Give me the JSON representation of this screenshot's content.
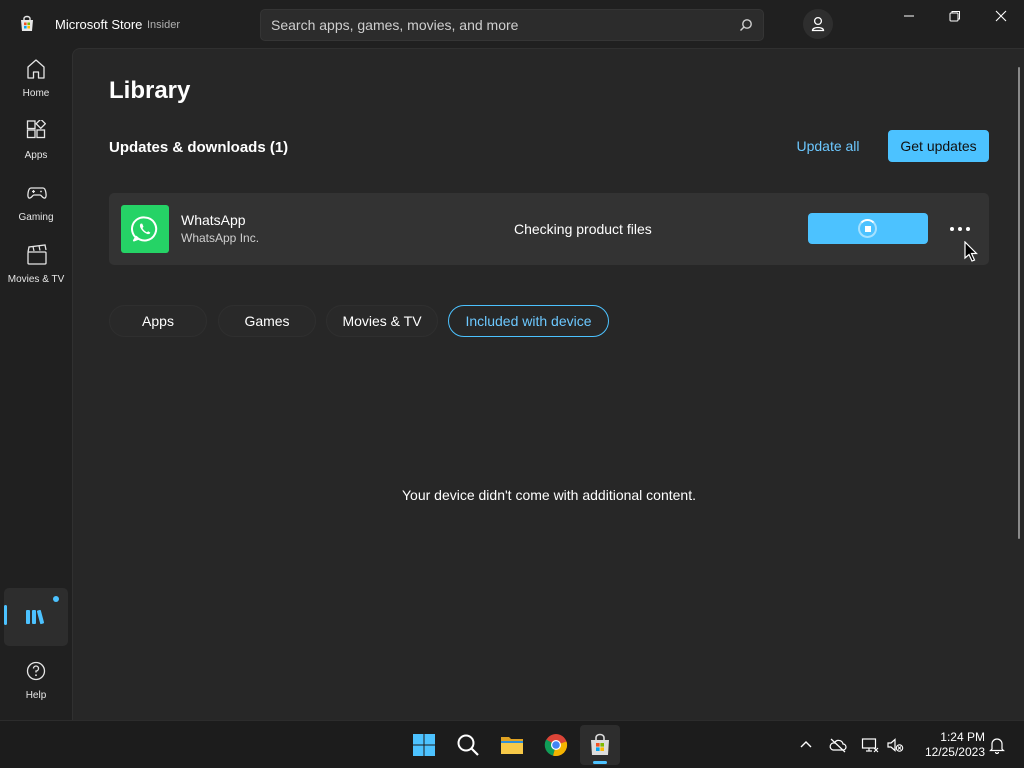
{
  "titlebar": {
    "app_name": "Microsoft Store",
    "badge": "Insider",
    "search_placeholder": "Search apps, games, movies, and more"
  },
  "sidebar": {
    "items": [
      {
        "label": "Home",
        "icon": "home-icon"
      },
      {
        "label": "Apps",
        "icon": "apps-icon"
      },
      {
        "label": "Gaming",
        "icon": "gamepad-icon"
      },
      {
        "label": "Movies & TV",
        "icon": "clapperboard-icon"
      }
    ],
    "library_icon": "library-icon",
    "help": {
      "label": "Help",
      "icon": "help-icon"
    }
  },
  "main": {
    "title": "Library",
    "section_title": "Updates & downloads (1)",
    "update_all_label": "Update all",
    "get_updates_label": "Get updates",
    "app": {
      "name": "WhatsApp",
      "publisher": "WhatsApp Inc.",
      "status": "Checking product files"
    },
    "filters": [
      "Apps",
      "Games",
      "Movies & TV",
      "Included with device"
    ],
    "active_filter": "Included with device",
    "empty_message": "Your device didn't come with additional content."
  },
  "taskbar": {
    "time": "1:24 PM",
    "date": "12/25/2023"
  },
  "colors": {
    "accent": "#4cc2ff",
    "background": "#202020",
    "panel": "#272727",
    "whatsapp": "#25d366"
  }
}
